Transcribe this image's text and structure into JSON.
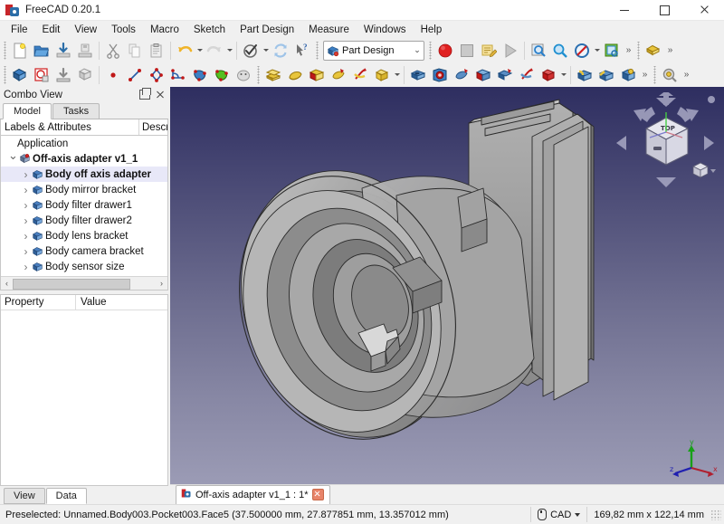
{
  "window": {
    "title": "FreeCAD 0.20.1",
    "app_icon": "freecad-logo-icon",
    "minimize": "–",
    "maximize": "□",
    "close": "×"
  },
  "menubar": {
    "items": [
      {
        "label": "File"
      },
      {
        "label": "Edit"
      },
      {
        "label": "View"
      },
      {
        "label": "Tools"
      },
      {
        "label": "Macro"
      },
      {
        "label": "Sketch"
      },
      {
        "label": "Part Design"
      },
      {
        "label": "Measure"
      },
      {
        "label": "Windows"
      },
      {
        "label": "Help"
      }
    ]
  },
  "toolbars": {
    "overflow_glyph": "»",
    "row1": {
      "file_group": [
        "new-document-icon",
        "open-document-icon",
        "save-document-icon",
        "save-as-icon"
      ],
      "edit_group": [
        "cut-icon",
        "copy-icon",
        "paste-icon"
      ],
      "history_group": [
        "undo-icon",
        "redo-icon"
      ],
      "refresh_group": [
        "whats-this-toggle-icon",
        "refresh-icon",
        "whats-this-help-icon"
      ],
      "workbench": {
        "icon": "part-design-workbench-icon",
        "label": "Part Design",
        "chevron": "⌄"
      },
      "macro_group": [
        "macro-record-icon",
        "macro-stop-icon",
        "macro-edit-icon",
        "macro-execute-icon"
      ],
      "view_group": [
        "fit-all-icon",
        "zoom-box-icon",
        "draw-style-icon",
        "axonometric-view-icon"
      ],
      "tail_group": [
        "std-view-group-icon"
      ]
    },
    "row2": {
      "partdesign_group": [
        "create-body-icon",
        "create-sketch-icon",
        "attachment-icon",
        "shape-binder-icon"
      ],
      "sketcher_group": [
        "point-icon",
        "line-icon",
        "polyline-icon",
        "arc-icon",
        "primitive-blue-icon",
        "primitive-green-icon",
        "validate-sketch-icon"
      ],
      "additive_group": [
        "pad-icon",
        "revolution-icon",
        "additive-loft-icon",
        "additive-pipe-icon",
        "additive-helix-icon",
        "additive-primitive-icon"
      ],
      "subtractive_group": [
        "pocket-icon",
        "hole-icon",
        "groove-icon",
        "subtractive-loft-icon",
        "subtractive-pipe-icon",
        "subtractive-helix-icon",
        "subtractive-primitive-icon"
      ],
      "dressup_group": [
        "fillet-icon",
        "chamfer-icon",
        "draft-icon"
      ],
      "measure_group": [
        "measure-icon"
      ]
    }
  },
  "combo_view": {
    "title": "Combo View",
    "float_icon": "undock-panel-icon",
    "close_icon": "close-panel-icon",
    "tabs": [
      {
        "label": "Model",
        "active": true
      },
      {
        "label": "Tasks",
        "active": false
      }
    ],
    "tree_headers": {
      "col1": "Labels & Attributes",
      "col2": "Descr"
    },
    "tree": [
      {
        "label": "Application",
        "depth": 0,
        "arrow": "none",
        "icon": "none",
        "bold": false,
        "selected": false
      },
      {
        "label": "Off-axis adapter v1_1",
        "depth": 1,
        "arrow": "open",
        "icon": "document-icon",
        "bold": true,
        "selected": false
      },
      {
        "label": "Body off axis adapter",
        "depth": 2,
        "arrow": "closed",
        "icon": "body-icon",
        "bold": true,
        "selected": true
      },
      {
        "label": "Body mirror bracket",
        "depth": 2,
        "arrow": "closed",
        "icon": "body-icon",
        "bold": false,
        "selected": false
      },
      {
        "label": "Body filter drawer1",
        "depth": 2,
        "arrow": "closed",
        "icon": "body-icon",
        "bold": false,
        "selected": false
      },
      {
        "label": "Body filter drawer2",
        "depth": 2,
        "arrow": "closed",
        "icon": "body-icon",
        "bold": false,
        "selected": false
      },
      {
        "label": "Body lens bracket",
        "depth": 2,
        "arrow": "closed",
        "icon": "body-icon",
        "bold": false,
        "selected": false
      },
      {
        "label": "Body camera bracket",
        "depth": 2,
        "arrow": "closed",
        "icon": "body-icon",
        "bold": false,
        "selected": false
      },
      {
        "label": "Body sensor size",
        "depth": 2,
        "arrow": "closed",
        "icon": "body-icon",
        "bold": false,
        "selected": false
      }
    ],
    "scroll_left": "‹",
    "scroll_right": "›",
    "property_headers": {
      "col1": "Property",
      "col2": "Value"
    },
    "property_rows": [],
    "property_tabs": [
      {
        "label": "View",
        "active": false
      },
      {
        "label": "Data",
        "active": true
      }
    ]
  },
  "view3d": {
    "background_top": "#2e2e60",
    "background_bottom": "#9b9bb5",
    "model_color": "#9a9a9a",
    "nav_cube": {
      "name": "navigation-cube",
      "top_face_label": "TOP",
      "arrows": [
        "rotate-left-arrow",
        "rotate-right-arrow",
        "pan-up-arrow",
        "pan-down-arrow",
        "pan-left-arrow",
        "pan-right-arrow"
      ],
      "corner_widget": "view-menu-cube"
    },
    "axis_cross": {
      "x_label": "x",
      "x_color": "#b02030",
      "y_label": "y",
      "y_color": "#18a018",
      "z_label": "z",
      "z_color": "#2020b0"
    },
    "tabs": [
      {
        "label": "Off-axis adapter v1_1 : 1*",
        "icon": "freecad-logo-icon",
        "close": "×",
        "active": true
      }
    ]
  },
  "statusbar": {
    "message": "Preselected: Unnamed.Body003.Pocket003.Face5 (37.500000 mm, 27.877851 mm, 13.357012 mm)",
    "nav_style": {
      "icon": "mouse-icon",
      "label": "CAD",
      "chevron": "▾"
    },
    "dimensions": "169,82 mm x 122,14 mm",
    "resize_grip": "resize-grip-icon"
  }
}
